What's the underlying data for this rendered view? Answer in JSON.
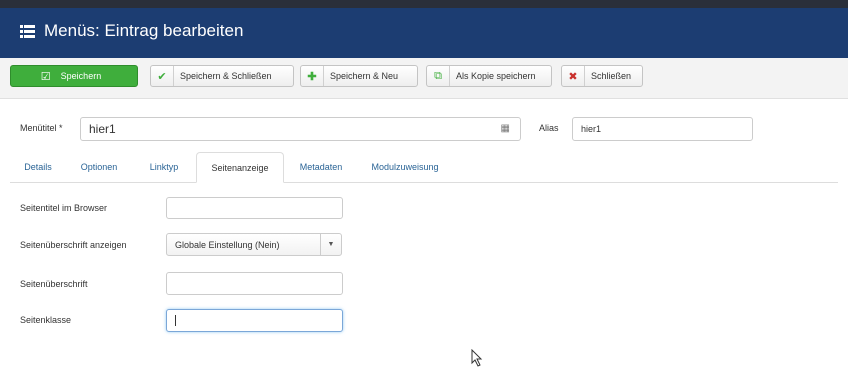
{
  "header": {
    "title": "Menüs: Eintrag bearbeiten"
  },
  "toolbar": {
    "save": "Speichern",
    "save_close": "Speichern & Schließen",
    "save_new": "Speichern & Neu",
    "save_copy": "Als Kopie speichern",
    "close": "Schließen"
  },
  "form": {
    "menutitle_label": "Menütitel *",
    "menutitle_value": "hier1",
    "alias_label": "Alias",
    "alias_value": "hier1"
  },
  "tabs": [
    "Details",
    "Optionen",
    "Linktyp",
    "Seitenanzeige",
    "Metadaten",
    "Modulzuweisung"
  ],
  "active_tab": "Seitenanzeige",
  "page_display": {
    "browser_title_label": "Seitentitel im Browser",
    "browser_title_value": "",
    "show_heading_label": "Seitenüberschrift anzeigen",
    "show_heading_value": "Globale Einstellung (Nein)",
    "heading_label": "Seitenüberschrift",
    "heading_value": "",
    "pageclass_label": "Seitenklasse",
    "pageclass_value": ""
  },
  "colors": {
    "header_bg": "#1c3d72",
    "save_green": "#3fae3c",
    "link_blue": "#2a6496"
  }
}
